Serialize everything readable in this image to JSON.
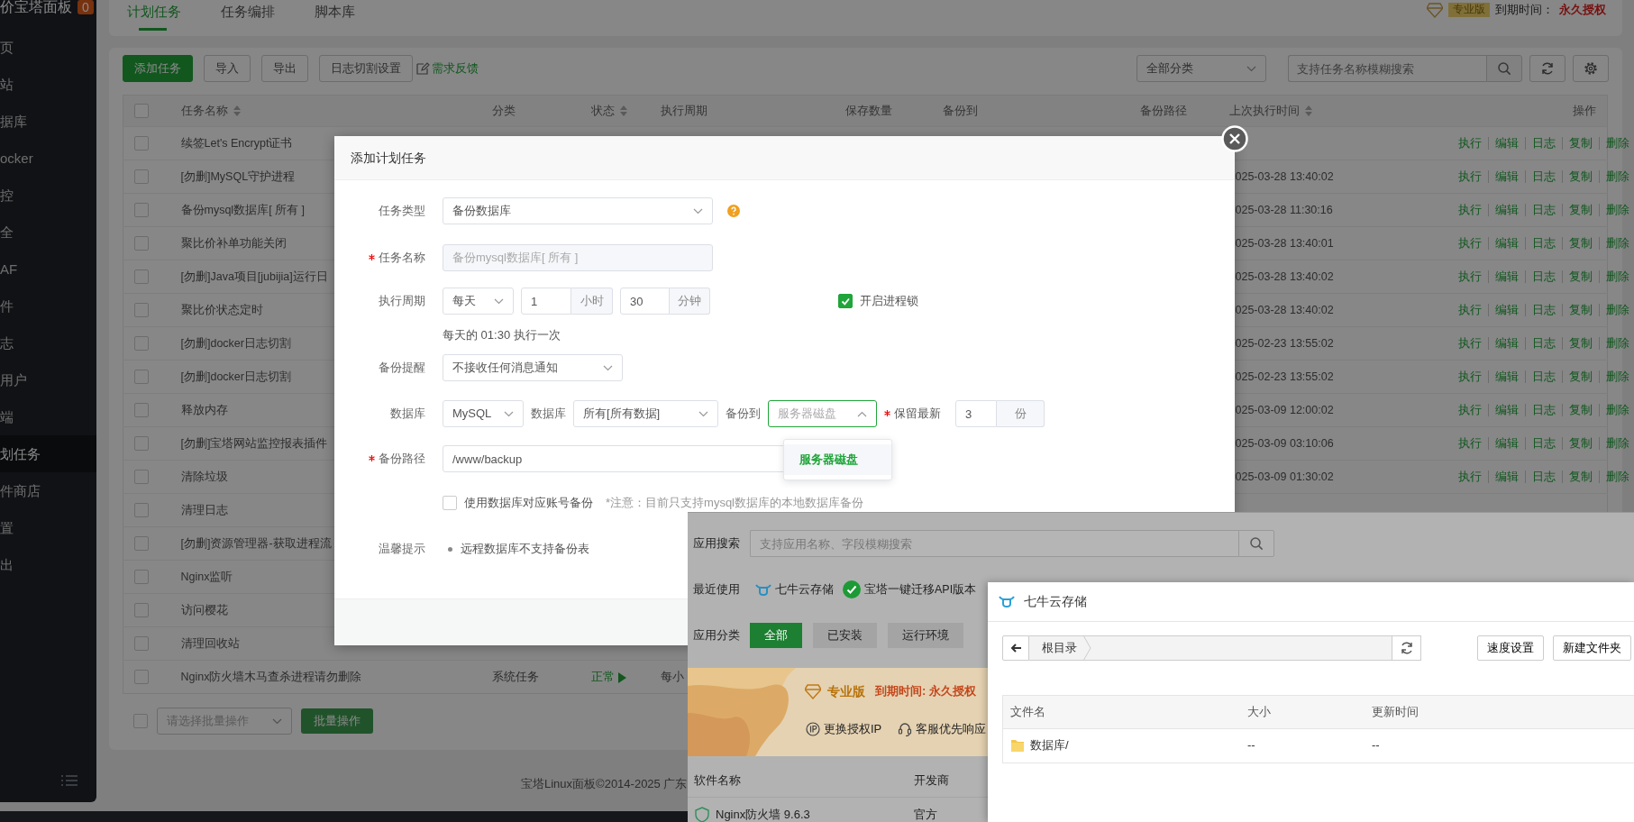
{
  "sidebar": {
    "title": "价宝塔面板",
    "badge": "0",
    "items": [
      {
        "label": "页",
        "selected": false
      },
      {
        "label": "站",
        "selected": false
      },
      {
        "label": "据库",
        "selected": false
      },
      {
        "label": "ocker",
        "selected": false
      },
      {
        "label": "控",
        "selected": false
      },
      {
        "label": "全",
        "selected": false
      },
      {
        "label": "AF",
        "selected": false
      },
      {
        "label": "件",
        "selected": false
      },
      {
        "label": "志",
        "selected": false
      },
      {
        "label": "用户",
        "selected": false
      },
      {
        "label": "端",
        "selected": false
      },
      {
        "label": "划任务",
        "selected": true
      },
      {
        "label": "件商店",
        "selected": false
      },
      {
        "label": "置",
        "selected": false
      },
      {
        "label": "出",
        "selected": false
      }
    ]
  },
  "tabs": [
    {
      "label": "计划任务",
      "selected": true
    },
    {
      "label": "任务编排",
      "selected": false
    },
    {
      "label": "脚本库",
      "selected": false
    }
  ],
  "license": {
    "edition": "专业版",
    "expiry_label": "到期时间：",
    "expiry_value": "永久授权"
  },
  "toolbar": {
    "buttons": [
      {
        "label": "添加任务",
        "kind": "primary"
      },
      {
        "label": "导入",
        "kind": "default"
      },
      {
        "label": "导出",
        "kind": "default"
      },
      {
        "label": "日志切割设置",
        "kind": "default"
      }
    ],
    "feedback_link": "需求反馈",
    "category_select": "全部分类",
    "search": {
      "placeholder": "支持任务名称模糊搜索"
    }
  },
  "table": {
    "select_all": {
      "checked": false
    },
    "columns": [
      {
        "label": "任务名称",
        "sortable": true
      },
      {
        "label": "分类",
        "sortable": false
      },
      {
        "label": "状态",
        "sortable": true
      },
      {
        "label": "执行周期",
        "sortable": false
      },
      {
        "label": "保存数量",
        "sortable": false
      },
      {
        "label": "备份到",
        "sortable": false
      },
      {
        "label": "备份路径",
        "sortable": false
      },
      {
        "label": "上次执行时间",
        "sortable": true
      },
      {
        "label": "操作",
        "sortable": false
      }
    ],
    "rows": [
      {
        "checked": false,
        "name": "续签Let's Encrypt证书",
        "actions": [
          "执行",
          "编辑",
          "日志",
          "复制",
          "删除"
        ]
      },
      {
        "checked": false,
        "name": "[勿删]MySQL守护进程",
        "last_run": "025-03-28 13:40:02",
        "actions": [
          "执行",
          "编辑",
          "日志",
          "复制",
          "删除"
        ]
      },
      {
        "checked": false,
        "name": "备份mysql数据库[ 所有 ]",
        "last_run": "025-03-28 11:30:16",
        "actions": [
          "执行",
          "编辑",
          "日志",
          "复制",
          "删除"
        ]
      },
      {
        "checked": false,
        "name": "聚比价补单功能关闭",
        "last_run": "025-03-28 13:40:01",
        "actions": [
          "执行",
          "编辑",
          "日志",
          "复制",
          "删除"
        ]
      },
      {
        "checked": false,
        "name": "[勿删]Java项目[jubijia]运行日",
        "last_run": "025-03-28 13:40:02",
        "actions": [
          "执行",
          "编辑",
          "日志",
          "复制",
          "删除"
        ]
      },
      {
        "checked": false,
        "name": "聚比价状态定时",
        "last_run": "025-03-28 13:40:02",
        "actions": [
          "执行",
          "编辑",
          "日志",
          "复制",
          "删除"
        ]
      },
      {
        "checked": false,
        "name": "[勿删]docker日志切割",
        "last_run": "025-02-23 13:55:02",
        "actions": [
          "执行",
          "编辑",
          "日志",
          "复制",
          "删除"
        ]
      },
      {
        "checked": false,
        "name": "[勿删]docker日志切割",
        "last_run": "025-02-23 13:55:02",
        "actions": [
          "执行",
          "编辑",
          "日志",
          "复制",
          "删除"
        ]
      },
      {
        "checked": false,
        "name": "释放内存",
        "last_run": "025-03-09 12:00:02",
        "actions": [
          "执行",
          "编辑",
          "日志",
          "复制",
          "删除"
        ]
      },
      {
        "checked": false,
        "name": "[勿删]宝塔网站监控报表插件",
        "last_run": "025-03-09 03:10:06",
        "actions": [
          "执行",
          "编辑",
          "日志",
          "复制",
          "删除"
        ]
      },
      {
        "checked": false,
        "name": "清除垃圾",
        "last_run": "025-03-09 01:30:02",
        "actions": [
          "执行",
          "编辑",
          "日志",
          "复制",
          "删除"
        ]
      },
      {
        "checked": false,
        "name": "清理日志"
      },
      {
        "checked": false,
        "name": "[勿删]资源管理器-获取进程流"
      },
      {
        "checked": false,
        "name": "Nginx监听"
      },
      {
        "checked": false,
        "name": "访问樱花"
      },
      {
        "checked": false,
        "name": "清理回收站"
      },
      {
        "checked": false,
        "name": "Nginx防火墙木马查杀进程请勿删除",
        "category": "系统任务",
        "status": "正常",
        "period": "每小"
      }
    ]
  },
  "bulk": {
    "checked": false,
    "placeholder": "请选择批量操作",
    "button": "批量操作",
    "disabled": true
  },
  "footer": "宝塔Linux面板©2014-2025 广东",
  "modal": {
    "title": "添加计划任务",
    "task_type": {
      "label": "任务类型",
      "value": "备份数据库"
    },
    "task_name": {
      "label": "任务名称",
      "required": true,
      "value": "备份mysql数据库[ 所有 ]",
      "disabled": true
    },
    "period": {
      "label": "执行周期",
      "frequency": "每天",
      "hour": "1",
      "hour_unit": "小时",
      "minute": "30",
      "minute_unit": "分钟",
      "hint": "每天的 01:30 执行一次"
    },
    "process_lock": {
      "label": "开启进程锁",
      "checked": true
    },
    "notify": {
      "label": "备份提醒",
      "value": "不接收任何消息通知"
    },
    "database": {
      "label": "数据库",
      "engine": "MySQL",
      "db_label": "数据库",
      "db_value": "所有[所有数据]",
      "target_label": "备份到",
      "target_placeholder": "服务器磁盘",
      "target_open": true,
      "keep_label": "保留最新",
      "keep_required": true,
      "keep_value": "3",
      "keep_unit": "份"
    },
    "target_options": [
      {
        "label": "服务器磁盘",
        "selected": true
      }
    ],
    "backup_path": {
      "label": "备份路径",
      "required": true,
      "value": "/www/backup"
    },
    "use_account": {
      "label": "使用数据库对应账号备份",
      "checked": false,
      "note": "*注意：目前只支持mysql数据库的本地数据库备份"
    },
    "tips": {
      "label": "温馨提示",
      "items": [
        "远程数据库不支持备份表"
      ]
    }
  },
  "app_store": {
    "search_label": "应用搜索",
    "search_placeholder": "支持应用名称、字段模糊搜索",
    "recent_label": "最近使用",
    "recent": [
      {
        "label": "七牛云存储",
        "kind": "qiniu"
      },
      {
        "label": "宝塔一键迁移API版本",
        "kind": "check"
      }
    ],
    "category_label": "应用分类",
    "categories": [
      {
        "label": "全部",
        "selected": true
      },
      {
        "label": "已安装",
        "selected": false
      },
      {
        "label": "运行环境",
        "selected": false
      }
    ],
    "banner": {
      "edition": "专业版",
      "expiry": "到期时间: 永久授权",
      "perks": [
        {
          "label": "更换授权IP",
          "kind": "ip"
        },
        {
          "label": "客服优先响应",
          "kind": "support"
        }
      ]
    },
    "columns": [
      "软件名称",
      "开发商"
    ],
    "rows": [
      {
        "name": "Nginx防火墙 9.6.3",
        "developer": "官方"
      }
    ]
  },
  "qiniu": {
    "title": "七牛云存储",
    "breadcrumb": "根目录",
    "buttons": [
      "速度设置",
      "新建文件夹"
    ],
    "columns": [
      "文件名",
      "大小",
      "更新时间"
    ],
    "rows": [
      {
        "name": "数据库/",
        "size": "--",
        "updated": "--",
        "kind": "folder"
      }
    ]
  }
}
